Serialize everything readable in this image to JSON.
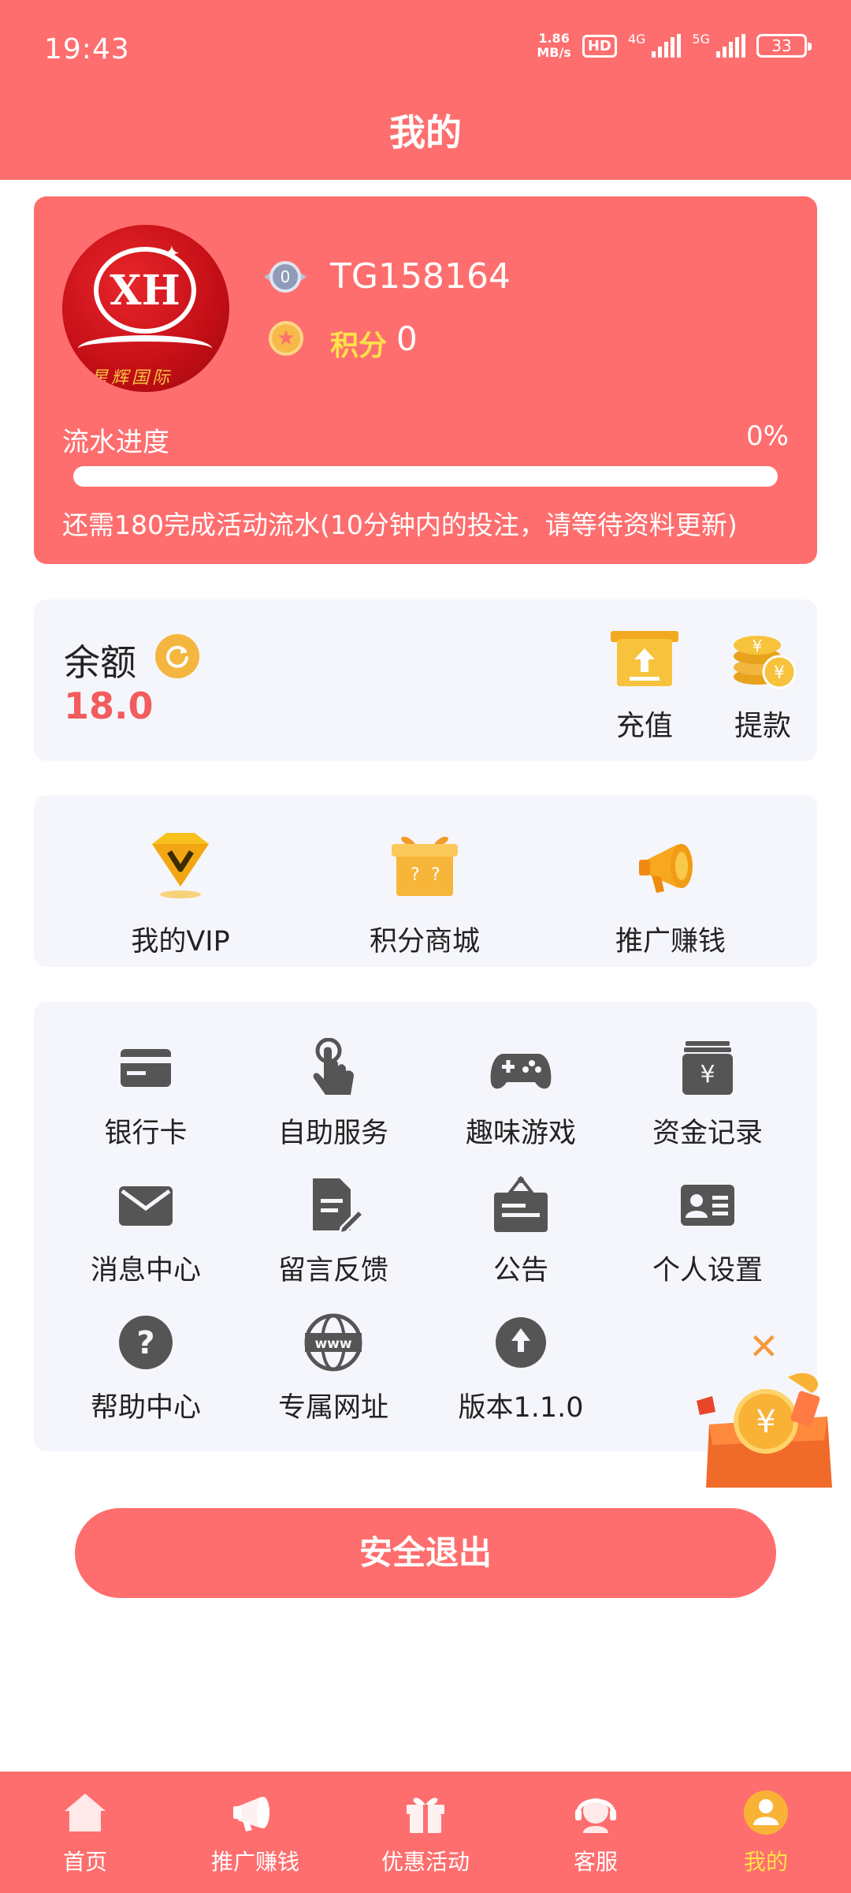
{
  "status_bar": {
    "time": "19:43",
    "net_speed_value": "1.86",
    "net_speed_unit": "MB/s",
    "hd_label": "HD",
    "net_4g": "4G",
    "net_5g": "5G",
    "battery": "33"
  },
  "header": {
    "title": "我的"
  },
  "profile": {
    "avatar_text": "星辉国际",
    "avatar_logo": "XH",
    "level": "0",
    "username": "TG158164",
    "points_label": "积分",
    "points_value": "0",
    "progress_label": "流水进度",
    "progress_percent_text": "0%",
    "progress_value": 0,
    "progress_note": "还需180完成活动流水(10分钟内的投注，请等待资料更新)"
  },
  "balance": {
    "label": "余额",
    "value": "18.0",
    "deposit_label": "充值",
    "withdraw_label": "提款"
  },
  "features": [
    {
      "label": "我的VIP",
      "icon": "vip-diamond-icon"
    },
    {
      "label": "积分商城",
      "icon": "gift-box-icon"
    },
    {
      "label": "推广赚钱",
      "icon": "megaphone-icon"
    }
  ],
  "grid": [
    {
      "label": "银行卡",
      "icon": "bank-card-icon"
    },
    {
      "label": "自助服务",
      "icon": "tap-hand-icon"
    },
    {
      "label": "趣味游戏",
      "icon": "gamepad-icon"
    },
    {
      "label": "资金记录",
      "icon": "money-record-icon"
    },
    {
      "label": "消息中心",
      "icon": "mail-icon"
    },
    {
      "label": "留言反馈",
      "icon": "feedback-edit-icon"
    },
    {
      "label": "公告",
      "icon": "notice-board-icon"
    },
    {
      "label": "个人设置",
      "icon": "id-card-icon"
    },
    {
      "label": "帮助中心",
      "icon": "help-icon"
    },
    {
      "label": "专属网址",
      "icon": "www-globe-icon"
    },
    {
      "label": "版本1.1.0",
      "icon": "upload-arrow-icon"
    }
  ],
  "logout_label": "安全退出",
  "tabs": [
    {
      "label": "首页",
      "icon": "home-icon",
      "active": false
    },
    {
      "label": "推广赚钱",
      "icon": "megaphone-icon",
      "active": false
    },
    {
      "label": "优惠活动",
      "icon": "gift-icon",
      "active": false
    },
    {
      "label": "客服",
      "icon": "headset-icon",
      "active": false
    },
    {
      "label": "我的",
      "icon": "user-icon",
      "active": true
    }
  ],
  "colors": {
    "brand": "#fe6e6e",
    "accent_yellow": "#ffe14a",
    "balance_red": "#f25c5c",
    "icon_gray": "#555555",
    "card_bg": "#f5f6fb"
  }
}
